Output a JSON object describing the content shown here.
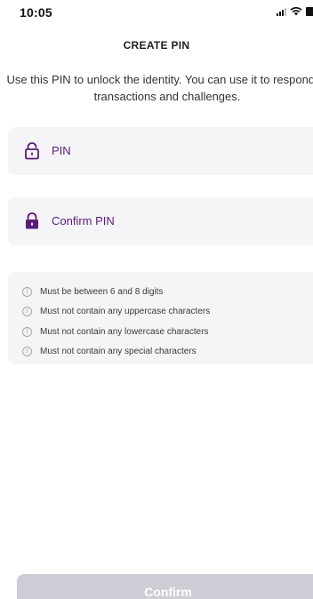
{
  "status_bar": {
    "time": "10:05"
  },
  "header": {
    "title": "CREATE PIN"
  },
  "description": "Use this PIN to unlock the identity. You can use it to respond to transactions and challenges.",
  "fields": {
    "pin": {
      "label": "PIN",
      "icon": "lock-open-icon"
    },
    "confirm_pin": {
      "label": "Confirm PIN",
      "icon": "lock-icon"
    }
  },
  "rules": [
    "Must be between 6 and 8 digits",
    "Must not contain any uppercase characters",
    "Must not contain any lowercase characters",
    "Must not contain any special characters"
  ],
  "rule_icon": "i",
  "confirm_button": {
    "label": "Confirm"
  },
  "colors": {
    "accent": "#5b1c78",
    "field_bg": "#f5f5f7",
    "button_disabled": "#cfccd6"
  }
}
